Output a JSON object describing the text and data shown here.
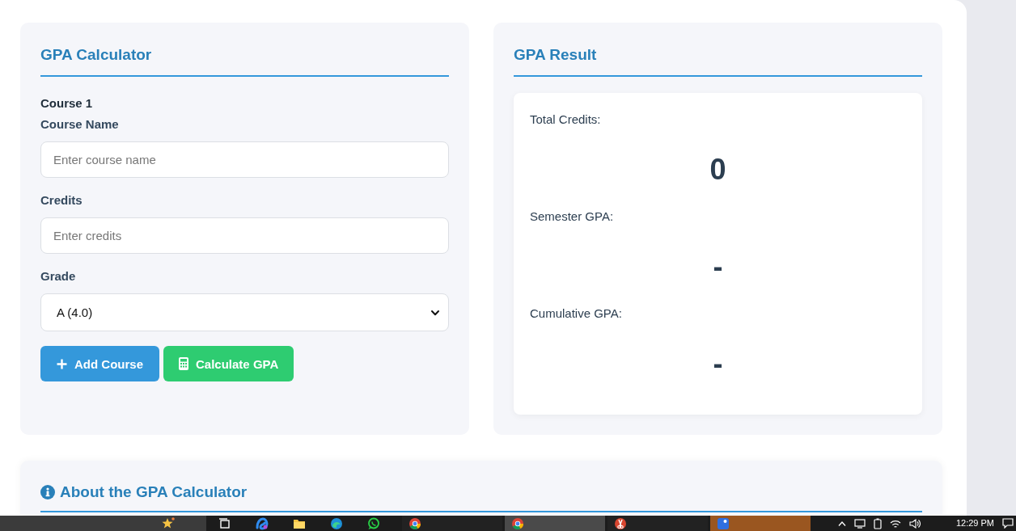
{
  "calculator": {
    "title": "GPA Calculator",
    "courses": [
      {
        "heading": "Course 1",
        "fields": [
          {
            "kind": "text",
            "label": "Course Name",
            "placeholder": "Enter course name"
          },
          {
            "kind": "text",
            "label": "Credits",
            "placeholder": "Enter credits"
          },
          {
            "kind": "select",
            "label": "Grade",
            "value": "A (4.0)"
          }
        ]
      }
    ],
    "buttons": [
      {
        "kind": "add",
        "label": "Add Course"
      },
      {
        "kind": "calculate",
        "label": "Calculate GPA"
      }
    ]
  },
  "result": {
    "title": "GPA Result",
    "stats": [
      {
        "label": "Total Credits:",
        "value": "0"
      },
      {
        "label": "Semester GPA:",
        "value": "-"
      },
      {
        "label": "Cumulative GPA:",
        "value": "-"
      }
    ]
  },
  "about": {
    "title": "About the GPA Calculator"
  },
  "taskbar": {
    "pinned": [
      {
        "kind": "taskview"
      },
      {
        "kind": "swirl"
      },
      {
        "kind": "folder"
      },
      {
        "kind": "wave"
      },
      {
        "kind": "chat"
      }
    ],
    "windows": [
      {
        "kind": "browser",
        "selected": false,
        "attention": false
      },
      {
        "kind": "browser",
        "selected": true,
        "attention": false
      },
      {
        "kind": "scissors",
        "selected": false,
        "attention": false
      },
      {
        "kind": "app",
        "selected": false,
        "attention": true
      }
    ],
    "clock": "12:29 PM"
  }
}
